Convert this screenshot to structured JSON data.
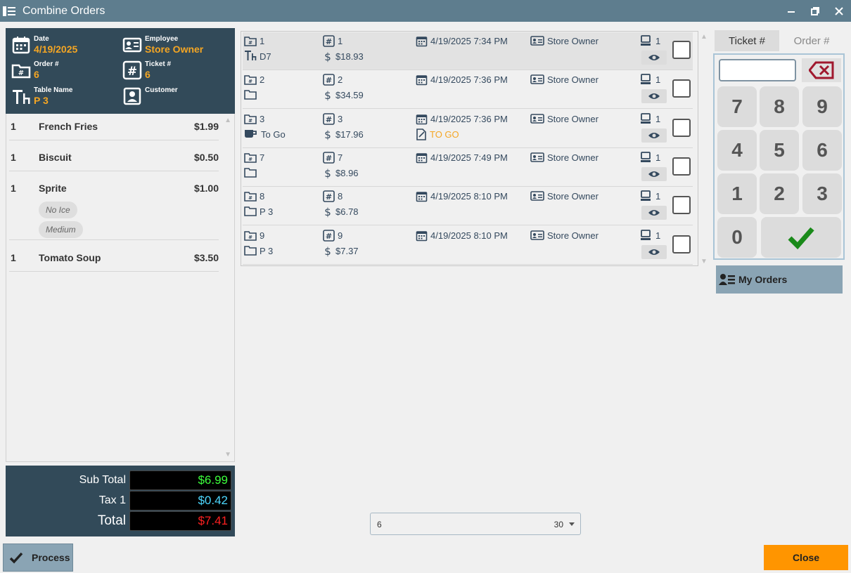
{
  "window": {
    "title": "Combine Orders"
  },
  "header": {
    "date_label": "Date",
    "date_value": "4/19/2025",
    "employee_label": "Employee",
    "employee_value": "Store Owner",
    "order_label": "Order #",
    "order_value": "6",
    "ticket_label": "Ticket #",
    "ticket_value": "6",
    "table_label": "Table Name",
    "table_value": "P 3",
    "customer_label": "Customer",
    "customer_value": ""
  },
  "items": [
    {
      "qty": "1",
      "name": "French Fries",
      "price": "$1.99"
    },
    {
      "qty": "1",
      "name": "Biscuit",
      "price": "$0.50"
    },
    {
      "qty": "1",
      "name": "Sprite",
      "price": "$1.00",
      "modifiers": [
        "No Ice",
        "Medium"
      ]
    },
    {
      "qty": "1",
      "name": "Tomato Soup",
      "price": "$3.50"
    }
  ],
  "totals": {
    "subtotal_label": "Sub Total",
    "subtotal_value": "$6.99",
    "tax_label": "Tax 1",
    "tax_value": "$0.42",
    "total_label": "Total",
    "total_value": "$7.41"
  },
  "process_label": "Process",
  "orders": [
    {
      "order": "1",
      "ticket": "1",
      "datetime": "4/19/2025 7:34 PM",
      "employee": "Store Owner",
      "terminal": "1",
      "table": "D7",
      "amount": "$18.93",
      "note": ""
    },
    {
      "order": "2",
      "ticket": "2",
      "datetime": "4/19/2025 7:36 PM",
      "employee": "Store Owner",
      "terminal": "1",
      "table": "",
      "amount": "$34.59",
      "note": ""
    },
    {
      "order": "3",
      "ticket": "3",
      "datetime": "4/19/2025 7:36 PM",
      "employee": "Store Owner",
      "terminal": "1",
      "table": "To Go",
      "amount": "$17.96",
      "note": "TO GO"
    },
    {
      "order": "7",
      "ticket": "7",
      "datetime": "4/19/2025 7:49 PM",
      "employee": "Store Owner",
      "terminal": "1",
      "table": "",
      "amount": "$8.96",
      "note": ""
    },
    {
      "order": "8",
      "ticket": "8",
      "datetime": "4/19/2025 8:10 PM",
      "employee": "Store Owner",
      "terminal": "1",
      "table": "P 3",
      "amount": "$6.78",
      "note": ""
    },
    {
      "order": "9",
      "ticket": "9",
      "datetime": "4/19/2025 8:10 PM",
      "employee": "Store Owner",
      "terminal": "1",
      "table": "P 3",
      "amount": "$7.37",
      "note": ""
    }
  ],
  "pager": {
    "value": "6",
    "count": "30"
  },
  "keypad": {
    "tab_ticket": "Ticket #",
    "tab_order": "Order #",
    "input_value": "",
    "keys": [
      "7",
      "8",
      "9",
      "4",
      "5",
      "6",
      "1",
      "2",
      "3",
      "0"
    ]
  },
  "my_orders_label": "My Orders",
  "close_label": "Close",
  "colors": {
    "accent": "#f5a623",
    "header_bg": "#324a59",
    "subtotal": "#3cff3c",
    "tax": "#4dd8ff",
    "total": "#ff2020",
    "close_bg": "#ff9500"
  }
}
